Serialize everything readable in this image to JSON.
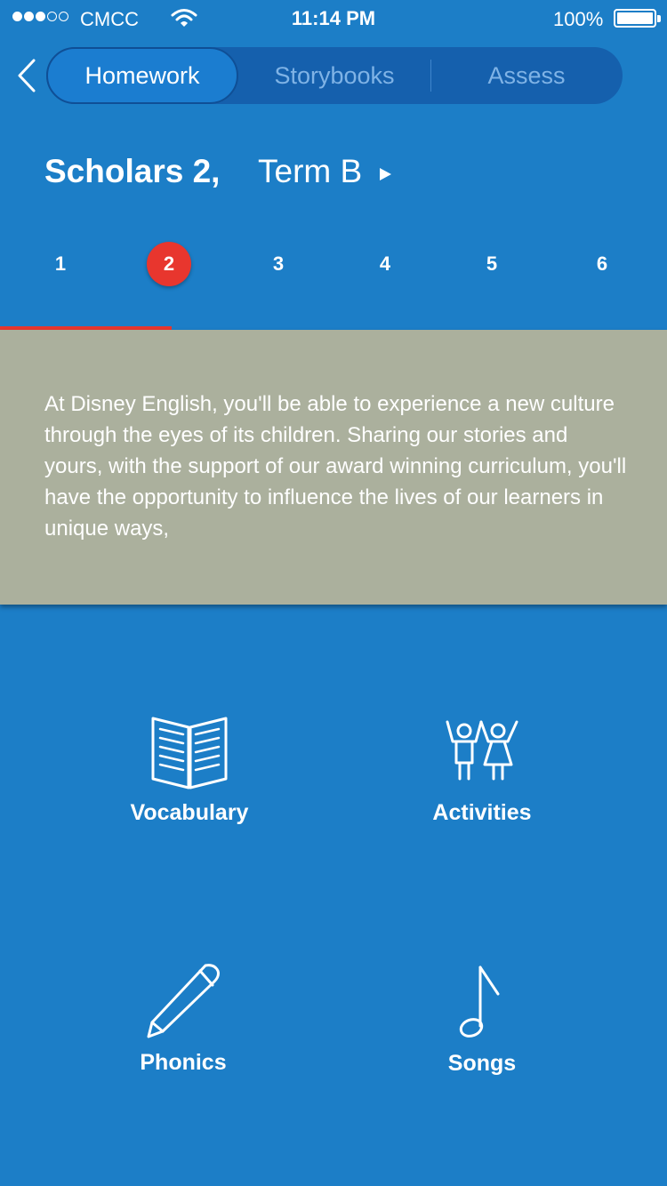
{
  "status_bar": {
    "carrier": "CMCC",
    "time": "11:14 PM",
    "battery": "100%",
    "signal_bars_filled": 3,
    "signal_bars_total": 5
  },
  "nav": {
    "back_icon": "chevron-left-icon",
    "tabs": [
      {
        "label": "Homework",
        "active": true
      },
      {
        "label": "Storybooks",
        "active": false
      },
      {
        "label": "Assess",
        "active": false
      }
    ]
  },
  "course": {
    "title": "Scholars 2,",
    "term": "Term B"
  },
  "units": {
    "items": [
      "1",
      "2",
      "3",
      "4",
      "5",
      "6"
    ],
    "selected": "2"
  },
  "description": "At Disney English, you'll be able to experience a new culture through the eyes of its children. Sharing our stories and yours, with the support of our award winning curriculum, you'll have the opportunity to influence the lives of our learners in unique ways,",
  "features": [
    {
      "label": "Vocabulary",
      "icon": "open-book-icon"
    },
    {
      "label": "Activities",
      "icon": "children-icon"
    },
    {
      "label": "Phonics",
      "icon": "pencil-icon"
    },
    {
      "label": "Songs",
      "icon": "music-note-icon"
    }
  ],
  "colors": {
    "background": "#1c7ec7",
    "segment_bg": "#1560ad",
    "accent_red": "#e8362e",
    "panel_bg": "#abb09d"
  }
}
